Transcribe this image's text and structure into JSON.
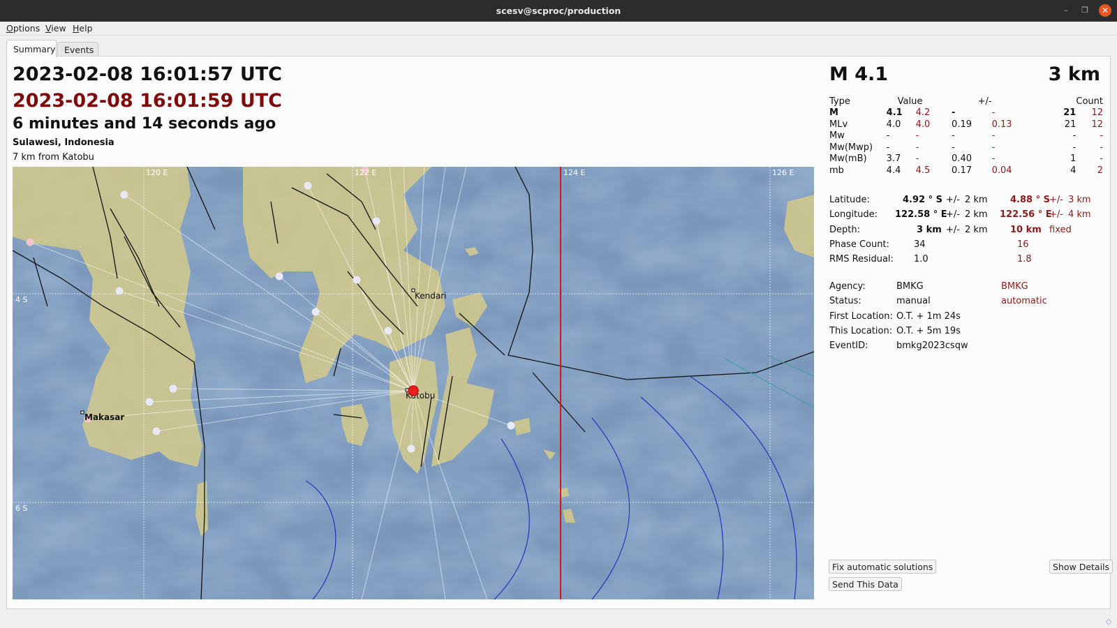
{
  "window": {
    "title": "scesv@scproc/production",
    "controls": {
      "minimize": "–",
      "maximize": "❐",
      "close": "✕"
    }
  },
  "menu": [
    {
      "label": "Options",
      "mnemonic": "O",
      "rest": "ptions"
    },
    {
      "label": "View",
      "mnemonic": "V",
      "rest": "iew"
    },
    {
      "label": "Help",
      "mnemonic": "H",
      "rest": "elp"
    }
  ],
  "tabs": [
    {
      "label": "Summary",
      "active": true
    },
    {
      "label": "Events",
      "active": false
    }
  ],
  "summary": {
    "origin_time": "2023-02-08 16:01:57 UTC",
    "origin_time_auto": "2023-02-08 16:01:59 UTC",
    "time_ago": "6 minutes and 14 seconds ago",
    "region": "Sulawesi, Indonesia",
    "nearest_city": "7 km from Katobu",
    "magnitude_big": "M 4.1",
    "depth_big": "3 km"
  },
  "magnitudes": {
    "headers": {
      "type": "Type",
      "value": "Value",
      "error": "+/-",
      "count": "Count"
    },
    "rows": [
      {
        "type": "M",
        "bold": true,
        "value": "4.1",
        "value_auto": "4.2",
        "error": "-",
        "error_auto": "-",
        "count": "21",
        "count_auto": "12"
      },
      {
        "type": "MLv",
        "bold": false,
        "value": "4.0",
        "value_auto": "4.0",
        "error": "0.19",
        "error_auto": "0.13",
        "count": "21",
        "count_auto": "12"
      },
      {
        "type": "Mw",
        "bold": false,
        "value": "-",
        "value_auto": "-",
        "error": "-",
        "error_auto": "-",
        "count": "-",
        "count_auto": "-"
      },
      {
        "type": "Mw(Mwp)",
        "bold": false,
        "value": "-",
        "value_auto": "-",
        "error": "-",
        "error_auto": "-",
        "count": "-",
        "count_auto": "-"
      },
      {
        "type": "Mw(mB)",
        "bold": false,
        "value": "3.7",
        "value_auto": "-",
        "error": "0.40",
        "error_auto": "-",
        "count": "1",
        "count_auto": "-"
      },
      {
        "type": "mb",
        "bold": false,
        "value": "4.4",
        "value_auto": "4.5",
        "error": "0.17",
        "error_auto": "0.04",
        "count": "4",
        "count_auto": "2"
      }
    ]
  },
  "location": {
    "latitude": {
      "label": "Latitude:",
      "value": "4.92 ° S",
      "pm": "+/-",
      "err": "2 km",
      "value_auto": "4.88 ° S",
      "pm_auto": "+/-",
      "err_auto": "3 km"
    },
    "longitude": {
      "label": "Longitude:",
      "value": "122.58 ° E",
      "pm": "+/-",
      "err": "2 km",
      "value_auto": "122.56 ° E",
      "pm_auto": "+/-",
      "err_auto": "4 km"
    },
    "depth": {
      "label": "Depth:",
      "value": "3 km",
      "pm": "+/-",
      "err": "2 km",
      "value_auto": "10 km",
      "note_auto": "fixed"
    },
    "phase_count": {
      "label": "Phase Count:",
      "value": "34",
      "value_auto": "16"
    },
    "rms": {
      "label": "RMS Residual:",
      "value": "1.0",
      "value_auto": "1.8"
    }
  },
  "info": {
    "agency": {
      "label": "Agency:",
      "value": "BMKG",
      "value_auto": "BMKG"
    },
    "status": {
      "label": "Status:",
      "value": "manual",
      "value_auto": "automatic"
    },
    "first_location": {
      "label": "First Location:",
      "value": "O.T. + 1m 24s"
    },
    "this_location": {
      "label": "This Location:",
      "value": "O.T. + 5m 19s"
    },
    "event_id": {
      "label": "EventID:",
      "value": "bmkg2023csqw"
    }
  },
  "buttons": {
    "fix_auto": "Fix automatic solutions",
    "show_details": "Show Details",
    "send_data": "Send This Data"
  },
  "map": {
    "grid_labels": {
      "lon_120": "120 E",
      "lon_122": "122 E",
      "lon_124": "124 E",
      "lon_126": "126 E",
      "lat_4": "4 S",
      "lat_6": "6 S"
    },
    "cities": [
      "Kendari",
      "Katobu",
      "Makasar"
    ],
    "colors": {
      "epicenter": "#e82020",
      "station": "#e8e8f8",
      "station_pink": "#f4c4cc",
      "fault": "#111111",
      "isochron": "#2233bb",
      "red_line": "#d01818",
      "land": "#c7c28f",
      "sea": "#6c8db4"
    }
  }
}
